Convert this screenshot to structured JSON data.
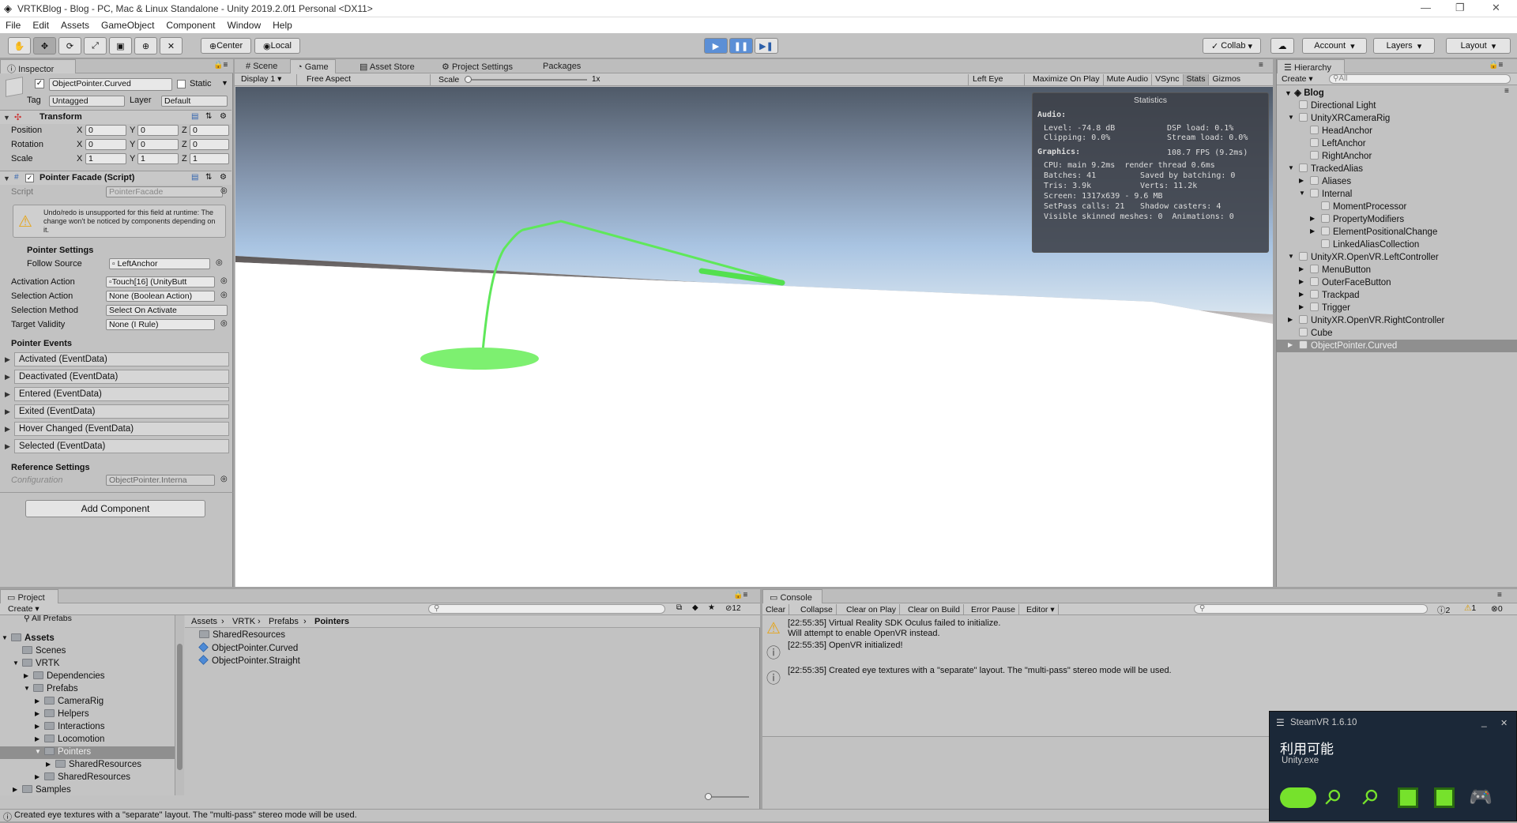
{
  "window": {
    "title": "VRTKBlog - Blog - PC, Mac & Linux Standalone - Unity 2019.2.0f1 Personal <DX11>",
    "minimize": "—",
    "maximize": "❐",
    "close": "✕"
  },
  "menu": [
    "File",
    "Edit",
    "Assets",
    "GameObject",
    "Component",
    "Window",
    "Help"
  ],
  "toolbar": {
    "tools": [
      "hand-tool",
      "move-tool",
      "rotate-tool",
      "scale-tool",
      "rect-tool",
      "transform-tool",
      "custom-tool"
    ],
    "pivot": "Center",
    "space": "Local",
    "collab": "Collab",
    "account": "Account",
    "layers": "Layers",
    "layout": "Layout"
  },
  "inspector": {
    "tab": "Inspector",
    "object_name": "ObjectPointer.Curved",
    "static_label": "Static",
    "tag_label": "Tag",
    "tag_value": "Untagged",
    "layer_label": "Layer",
    "layer_value": "Default",
    "transform": {
      "title": "Transform",
      "rows": [
        {
          "label": "Position",
          "x": "0",
          "y": "0",
          "z": "0"
        },
        {
          "label": "Rotation",
          "x": "0",
          "y": "0",
          "z": "0"
        },
        {
          "label": "Scale",
          "x": "1",
          "y": "1",
          "z": "1"
        }
      ]
    },
    "script_component": {
      "title": "Pointer Facade (Script)",
      "script_label": "Script",
      "script_value": "PointerFacade",
      "warning": "Undo/redo is unsupported for this field at runtime: The change won't be noticed by components depending on it.",
      "pointer_settings": "Pointer Settings",
      "follow_source_label": "Follow Source",
      "follow_source_value": "LeftAnchor",
      "fields": [
        {
          "label": "Activation Action",
          "value": "Touch[16] (UnityButt"
        },
        {
          "label": "Selection Action",
          "value": "None (Boolean Action)"
        },
        {
          "label": "Selection Method",
          "value": "Select On Activate"
        },
        {
          "label": "Target Validity",
          "value": "None (I Rule)"
        }
      ],
      "pointer_events": "Pointer Events",
      "events": [
        "Activated (EventData)",
        "Deactivated (EventData)",
        "Entered (EventData)",
        "Exited (EventData)",
        "Hover Changed (EventData)",
        "Selected (EventData)"
      ],
      "reference_settings": "Reference Settings",
      "configuration_label": "Configuration",
      "configuration_value": "ObjectPointer.Interna"
    },
    "add_component": "Add Component"
  },
  "game": {
    "tabs": [
      "Scene",
      "Game",
      "Asset Store",
      "Project Settings",
      "Packages"
    ],
    "display": "Display 1",
    "aspect": "Free Aspect",
    "scale_label": "Scale",
    "scale_value": "1x",
    "eye": "Left Eye",
    "buttons": [
      "Maximize On Play",
      "Mute Audio",
      "VSync",
      "Stats",
      "Gizmos"
    ],
    "stats": {
      "title": "Statistics",
      "audio_h": "Audio:",
      "level": "Level: -74.8 dB",
      "clipping": "Clipping: 0.0%",
      "dsp": "DSP load: 0.1%",
      "stream": "Stream load: 0.0%",
      "graphics_h": "Graphics:",
      "fps": "108.7 FPS (9.2ms)",
      "cpu": "CPU: main 9.2ms  render thread 0.6ms",
      "batches": "Batches: 41",
      "saved": "Saved by batching: 0",
      "tris": "Tris: 3.9k",
      "verts": "Verts: 11.2k",
      "screen": "Screen: 1317x639 - 9.6 MB",
      "setpass": "SetPass calls: 21",
      "shadow": "Shadow casters: 4",
      "skinned": "Visible skinned meshes: 0  Animations: 0"
    }
  },
  "hierarchy": {
    "tab": "Hierarchy",
    "create": "Create",
    "search_placeholder": "All",
    "scene": "Blog",
    "items": [
      {
        "label": "Directional Light",
        "depth": 1
      },
      {
        "label": "UnityXRCameraRig",
        "depth": 1
      },
      {
        "label": "HeadAnchor",
        "depth": 2
      },
      {
        "label": "LeftAnchor",
        "depth": 2
      },
      {
        "label": "RightAnchor",
        "depth": 2
      },
      {
        "label": "TrackedAlias",
        "depth": 1
      },
      {
        "label": "Aliases",
        "depth": 2
      },
      {
        "label": "Internal",
        "depth": 2
      },
      {
        "label": "MomentProcessor",
        "depth": 3
      },
      {
        "label": "PropertyModifiers",
        "depth": 3
      },
      {
        "label": "ElementPositionalChange",
        "depth": 3
      },
      {
        "label": "LinkedAliasCollection",
        "depth": 3
      },
      {
        "label": "UnityXR.OpenVR.LeftController",
        "depth": 1
      },
      {
        "label": "MenuButton",
        "depth": 2
      },
      {
        "label": "OuterFaceButton",
        "depth": 2
      },
      {
        "label": "Trackpad",
        "depth": 2
      },
      {
        "label": "Trigger",
        "depth": 2
      },
      {
        "label": "UnityXR.OpenVR.RightController",
        "depth": 1
      },
      {
        "label": "Cube",
        "depth": 1
      },
      {
        "label": "ObjectPointer.Curved",
        "depth": 1
      }
    ]
  },
  "project": {
    "tab": "Project",
    "create": "Create",
    "hidden_count": "12",
    "favorites": "All Prefabs",
    "tree": [
      {
        "label": "Assets",
        "depth": 0
      },
      {
        "label": "Scenes",
        "depth": 1
      },
      {
        "label": "VRTK",
        "depth": 1
      },
      {
        "label": "Dependencies",
        "depth": 2
      },
      {
        "label": "Prefabs",
        "depth": 2
      },
      {
        "label": "CameraRig",
        "depth": 3
      },
      {
        "label": "Helpers",
        "depth": 3
      },
      {
        "label": "Interactions",
        "depth": 3
      },
      {
        "label": "Locomotion",
        "depth": 3
      },
      {
        "label": "Pointers",
        "depth": 3
      },
      {
        "label": "SharedResources",
        "depth": 4
      },
      {
        "label": "SharedResources",
        "depth": 3
      },
      {
        "label": "Samples",
        "depth": 1
      }
    ],
    "breadcrumb": [
      "Assets",
      "VRTK",
      "Prefabs",
      "Pointers"
    ],
    "files": [
      "SharedResources",
      "ObjectPointer.Curved",
      "ObjectPointer.Straight"
    ]
  },
  "console": {
    "tab": "Console",
    "buttons": [
      "Clear",
      "Collapse",
      "Clear on Play",
      "Clear on Build",
      "Error Pause",
      "Editor"
    ],
    "counts": {
      "info": "2",
      "warn": "1",
      "error": "0"
    },
    "messages": [
      {
        "text": "[22:55:35] Virtual Reality SDK Oculus failed to initialize.",
        "text2": "Will attempt to enable OpenVR instead."
      },
      {
        "text": "[22:55:35] OpenVR initialized!",
        "text2": ""
      },
      {
        "text": "[22:55:35] Created eye textures with a \"separate\" layout.  The \"multi-pass\" stereo mode will be used.",
        "text2": ""
      }
    ]
  },
  "status_bar": "Created eye textures with a \"separate\" layout.  The \"multi-pass\" stereo mode will be used.",
  "steamvr": {
    "title": "SteamVR 1.6.10",
    "status": "利用可能",
    "app": "Unity.exe",
    "accent": "#76e22c"
  }
}
